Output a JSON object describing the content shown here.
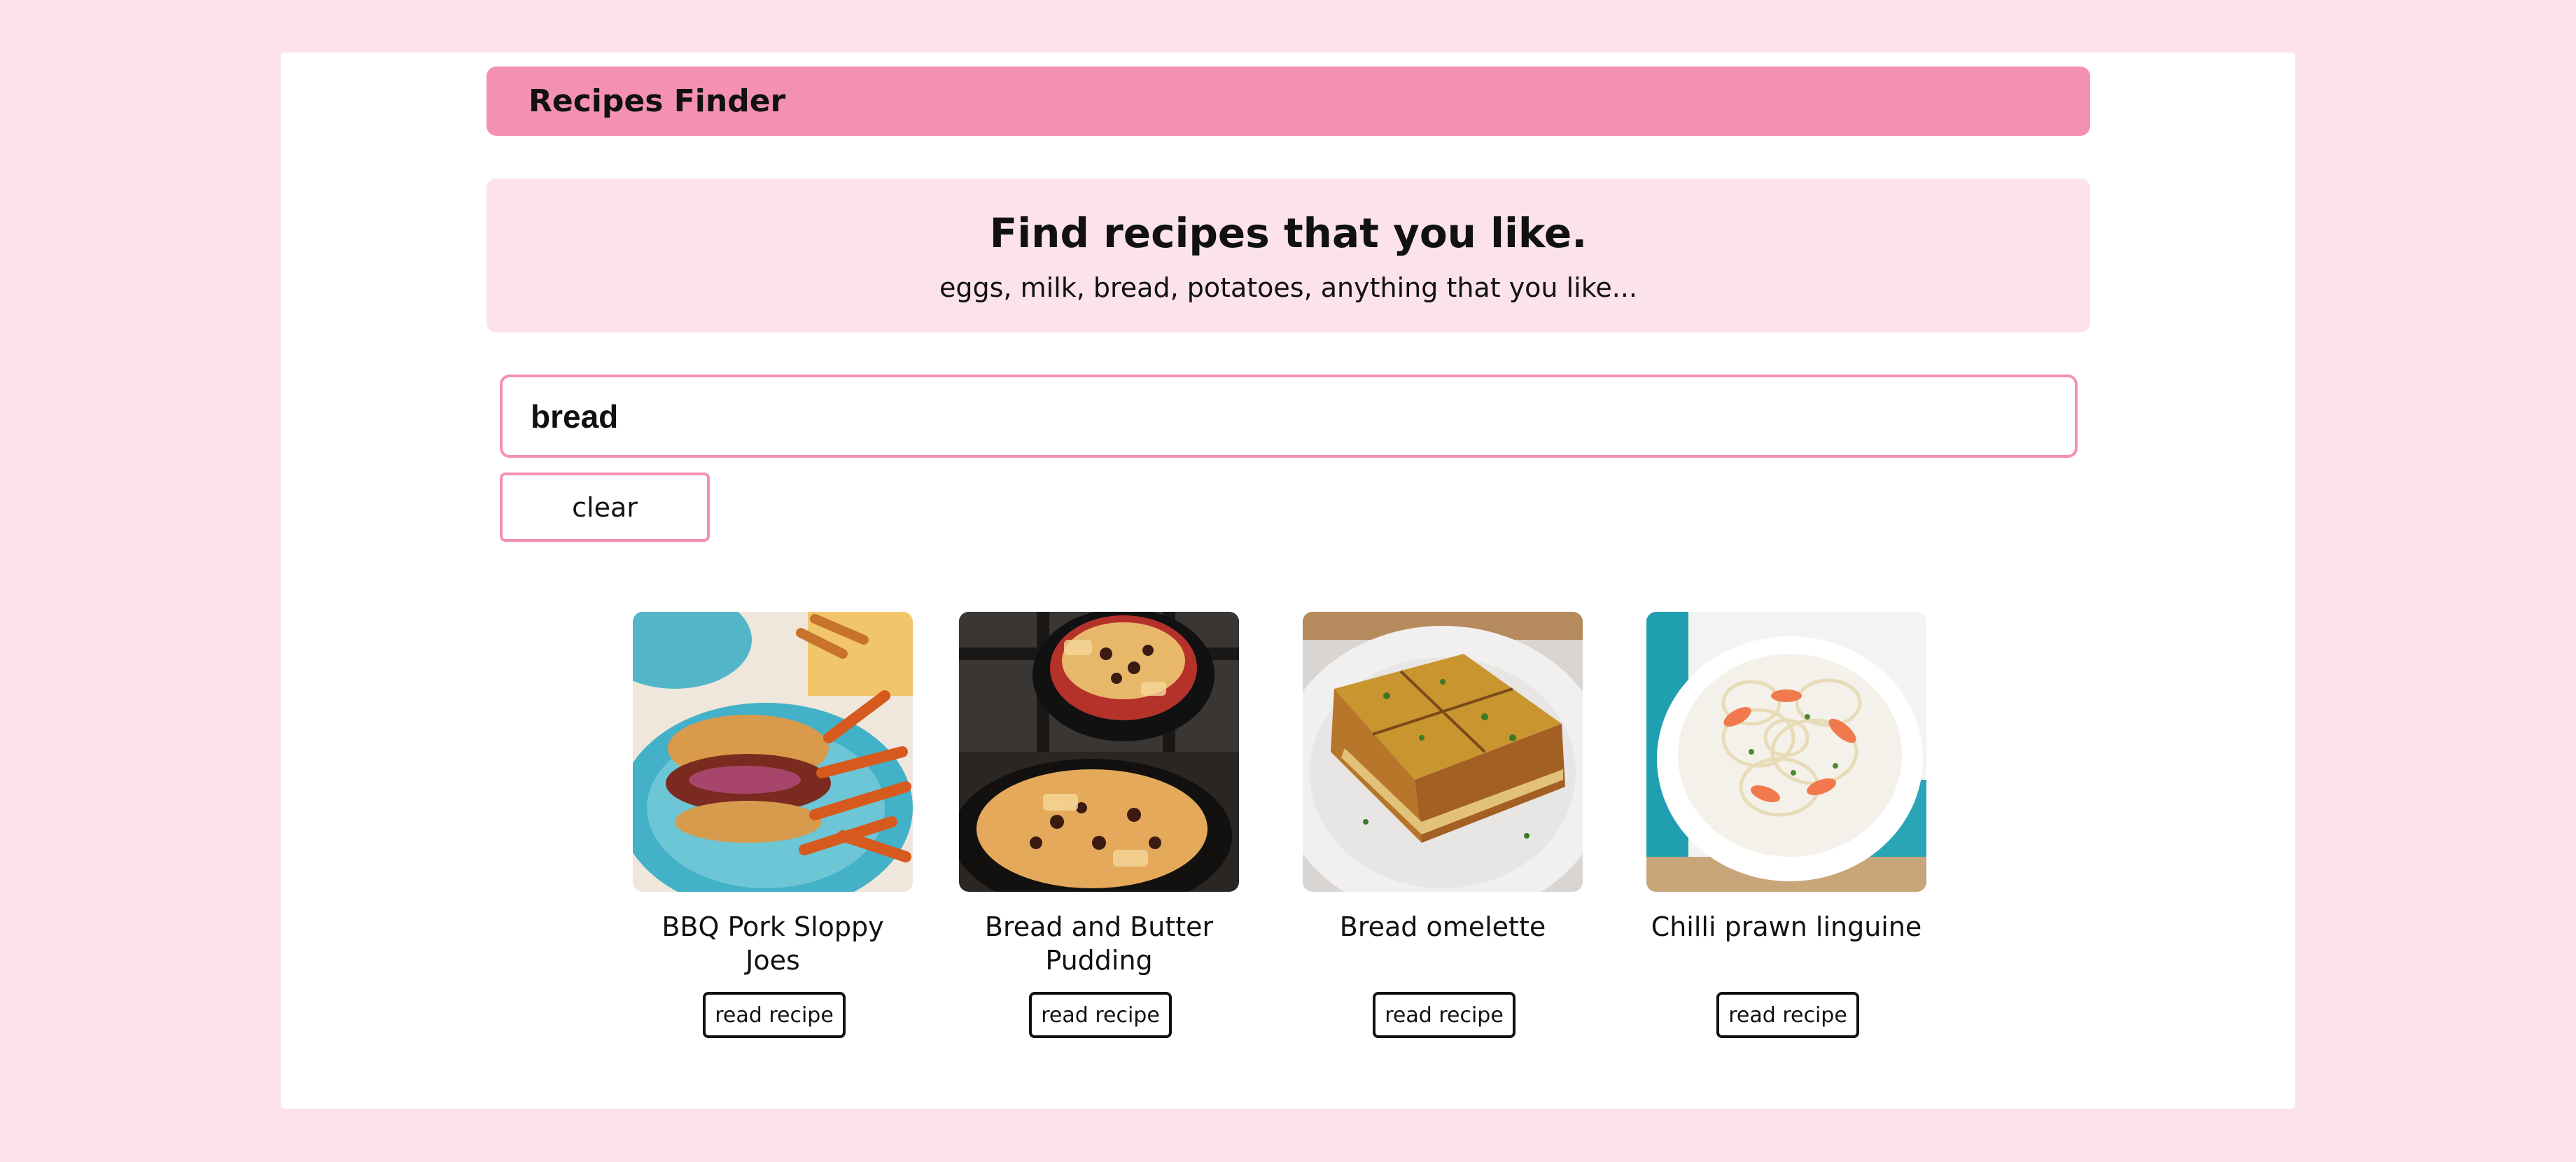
{
  "header": {
    "title": "Recipes Finder"
  },
  "hero": {
    "title": "Find recipes that you like.",
    "subtitle": "eggs, milk, bread, potatoes, anything that you like..."
  },
  "search": {
    "value": "bread"
  },
  "clear_label": "clear",
  "colors": {
    "background": "#fbe2eb",
    "header": "#f491b2",
    "accent_border": "#f491b2",
    "panel": "#ffffff"
  },
  "recipes": [
    {
      "name": "BBQ Pork Sloppy Joes",
      "button": "read recipe",
      "image": "bbq-pork-sloppy-joes-photo"
    },
    {
      "name": "Bread and Butter Pudding",
      "button": "read recipe",
      "image": "bread-and-butter-pudding-photo"
    },
    {
      "name": "Bread omelette",
      "button": "read recipe",
      "image": "bread-omelette-photo"
    },
    {
      "name": "Chilli prawn linguine",
      "button": "read recipe",
      "image": "chilli-prawn-linguine-photo"
    }
  ]
}
